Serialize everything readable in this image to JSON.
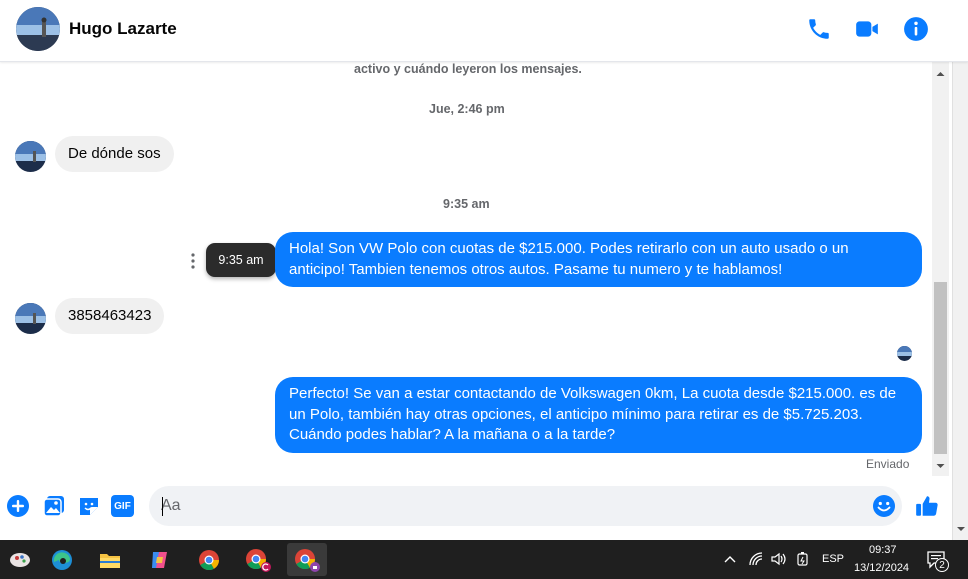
{
  "header": {
    "contact_name": "Hugo Lazarte",
    "icons": [
      "phone-icon",
      "video-call-icon",
      "info-icon"
    ],
    "accent_color": "#0a7cff"
  },
  "chat": {
    "system_note": "activo y cuándo leyeron los mensajes.",
    "messages": [
      {
        "type": "timestamp",
        "text": "Jue, 2:46 pm"
      },
      {
        "type": "incoming",
        "text": "De dónde sos"
      },
      {
        "type": "timestamp",
        "text": "9:35 am"
      },
      {
        "type": "outgoing",
        "lines": [
          "Hola! Son VW Polo con cuotas de $215.000. Podes retirarlo con un auto usado o un",
          "anticipo! Tambien tenemos otros autos. Pasame tu numero y te hablamos!"
        ],
        "tooltip": "9:35 am"
      },
      {
        "type": "incoming",
        "text": "3858463423"
      },
      {
        "type": "outgoing",
        "lines": [
          "Perfecto!  Se van a estar contactando de Volkswagen 0km, La cuota desde $215.000. es de",
          "un Polo, también hay otras opciones, el anticipo mínimo para retirar es de $5.725.203.",
          "Cuándo podes hablar? A la mañana o a la tarde?"
        ]
      }
    ],
    "sent_status": "Enviado"
  },
  "composer": {
    "placeholder": "Aa",
    "value": "",
    "icons": [
      "plus-icon",
      "image-icon",
      "sticker-icon",
      "gif-icon",
      "emoji-icon",
      "like-icon"
    ],
    "gif_label": "GIF"
  },
  "taskbar": {
    "apps": [
      "app-icon",
      "edge-icon",
      "file-explorer-icon",
      "copilot-icon",
      "chrome-icon",
      "chrome-profile-c-icon",
      "chrome-profile-active-icon"
    ],
    "language": "ESP",
    "time": "09:37",
    "date": "13/12/2024",
    "notifications_count": "2"
  }
}
